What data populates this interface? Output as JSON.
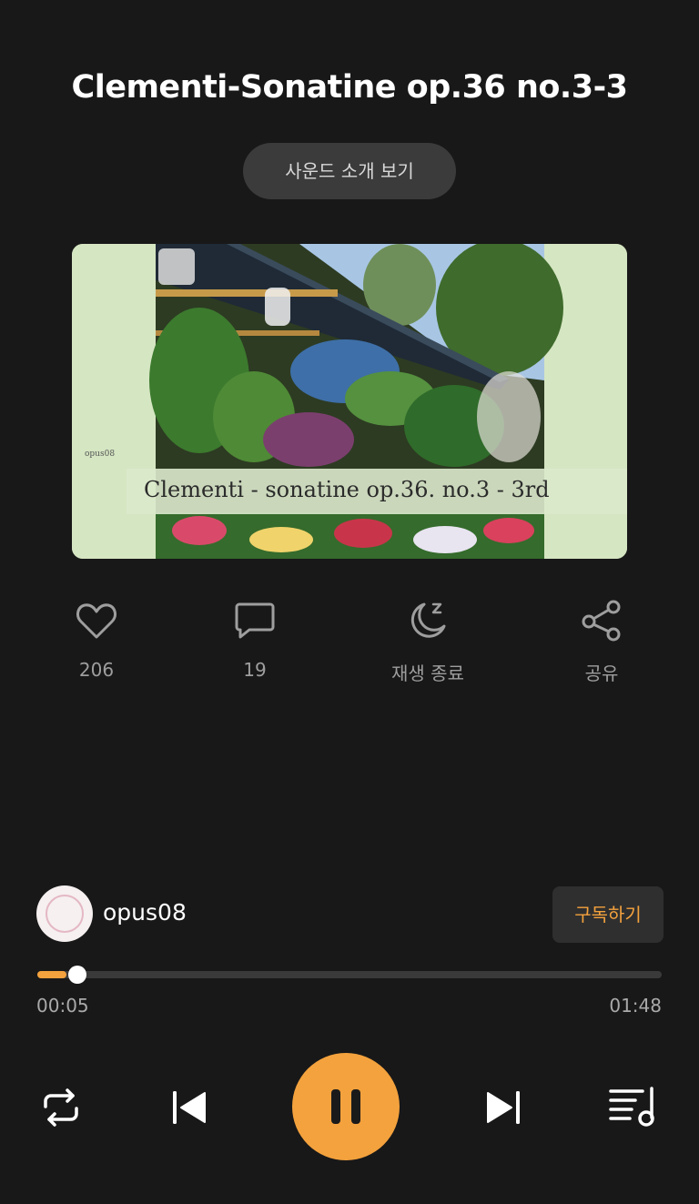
{
  "track": {
    "title": "Clementi-Sonatine op.36 no.3-3",
    "sound_intro_label": "사운드 소개 보기"
  },
  "artwork": {
    "caption": "Clementi - sonatine op.36. no.3 - 3rd",
    "watermark": "opus08"
  },
  "actions": {
    "like_count": "206",
    "comment_count": "19",
    "sleep_timer_label": "재생 종료",
    "share_label": "공유"
  },
  "channel": {
    "name": "opus08",
    "subscribe_label": "구독하기"
  },
  "player": {
    "current_time": "00:05",
    "total_time": "01:48",
    "progress_fraction": 0.0463,
    "accent_color": "#f4a23d"
  },
  "icons": {
    "like": "heart-icon",
    "comment": "comment-icon",
    "sleep": "moon-sleep-icon",
    "share": "share-icon",
    "repeat": "repeat-icon",
    "previous": "skip-previous-icon",
    "pause": "pause-icon",
    "next": "skip-next-icon",
    "playlist": "playlist-icon"
  }
}
